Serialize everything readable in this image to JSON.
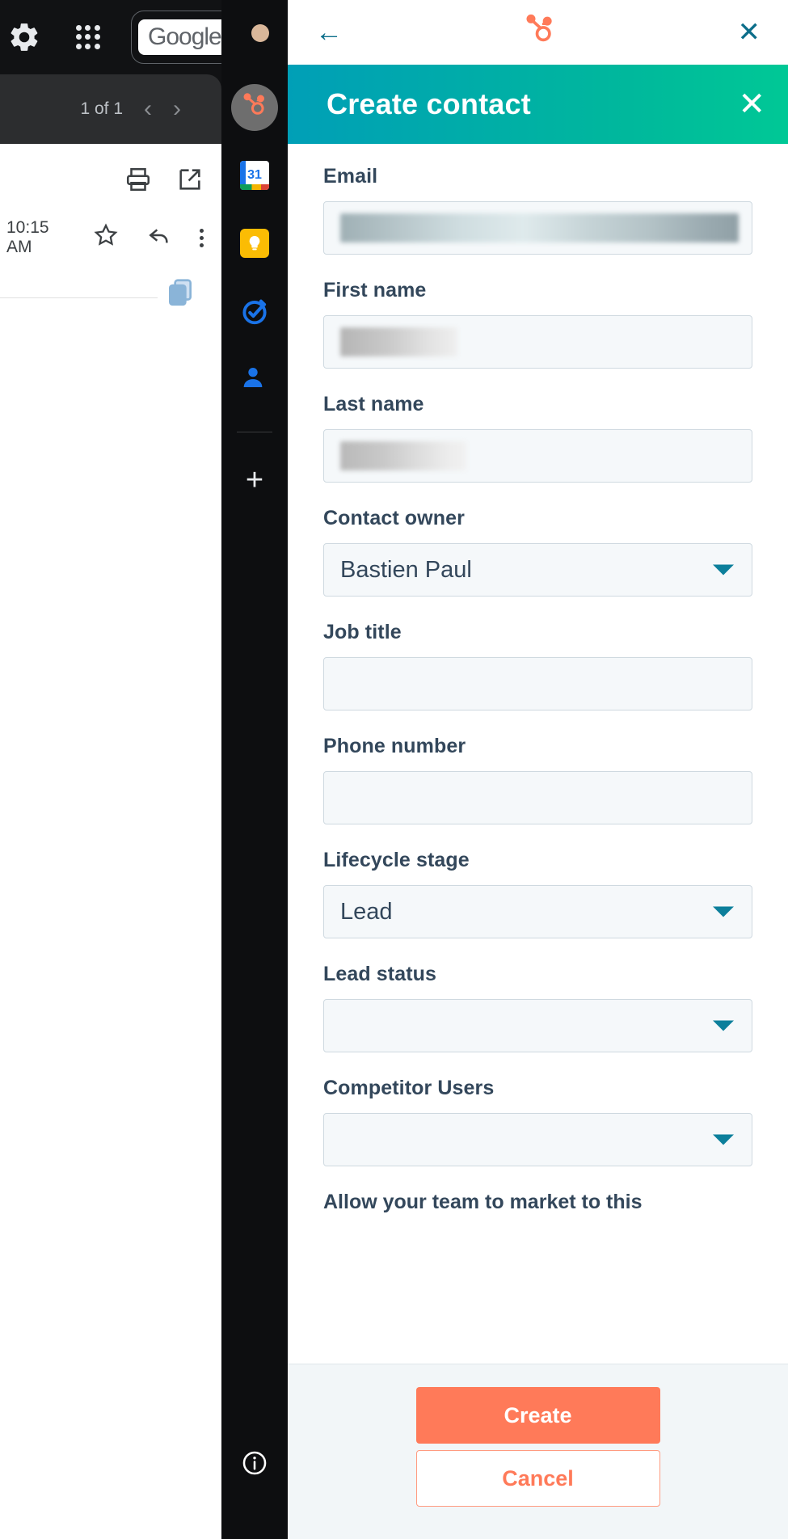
{
  "gmail": {
    "topbar": {
      "settings_icon": "gear-icon",
      "apps_icon": "apps-grid-icon",
      "brand_label": "Google",
      "avatar": "user-avatar"
    },
    "nav": {
      "counter": "1 of 1",
      "prev_label": "‹",
      "next_label": "›"
    },
    "message": {
      "print_icon": "print-icon",
      "open_in_new_icon": "open-in-new-icon",
      "timestamp": "10:15 AM",
      "star_icon": "star-icon",
      "reply_icon": "reply-icon",
      "more_icon": "more-vertical-icon",
      "copy_icon": "copy-icon"
    }
  },
  "rail": {
    "items": [
      {
        "name": "hubspot-icon",
        "label": "HubSpot",
        "active": true
      },
      {
        "name": "google-calendar-icon",
        "label": "Calendar",
        "badge": "31",
        "active": false
      },
      {
        "name": "google-keep-icon",
        "label": "Keep",
        "active": false
      },
      {
        "name": "google-tasks-icon",
        "label": "Tasks",
        "active": false
      },
      {
        "name": "google-contacts-icon",
        "label": "Contacts",
        "active": false
      }
    ],
    "add_label": "+",
    "info_icon": "info-icon"
  },
  "panel": {
    "topbar": {
      "back_label": "←",
      "logo": "hubspot-logo-icon",
      "close_label": "✕"
    },
    "header": {
      "title": "Create contact",
      "close_label": "✕",
      "gradient_start": "#009fb7",
      "gradient_end": "#00c896"
    },
    "fields": [
      {
        "label": "Email",
        "type": "text",
        "value": "",
        "redacted": "email"
      },
      {
        "label": "First name",
        "type": "text",
        "value": "",
        "redacted": "first"
      },
      {
        "label": "Last name",
        "type": "text",
        "value": "",
        "redacted": "last"
      },
      {
        "label": "Contact owner",
        "type": "select",
        "value": "Bastien Paul"
      },
      {
        "label": "Job title",
        "type": "text",
        "value": ""
      },
      {
        "label": "Phone number",
        "type": "text",
        "value": ""
      },
      {
        "label": "Lifecycle stage",
        "type": "select",
        "value": "Lead"
      },
      {
        "label": "Lead status",
        "type": "select",
        "value": ""
      },
      {
        "label": "Competitor Users",
        "type": "select",
        "value": ""
      }
    ],
    "truncated_label": "Allow your team to market to this",
    "footer": {
      "create_label": "Create",
      "cancel_label": "Cancel",
      "create_color": "#ff7a59",
      "cancel_color": "#ff7a59"
    }
  }
}
